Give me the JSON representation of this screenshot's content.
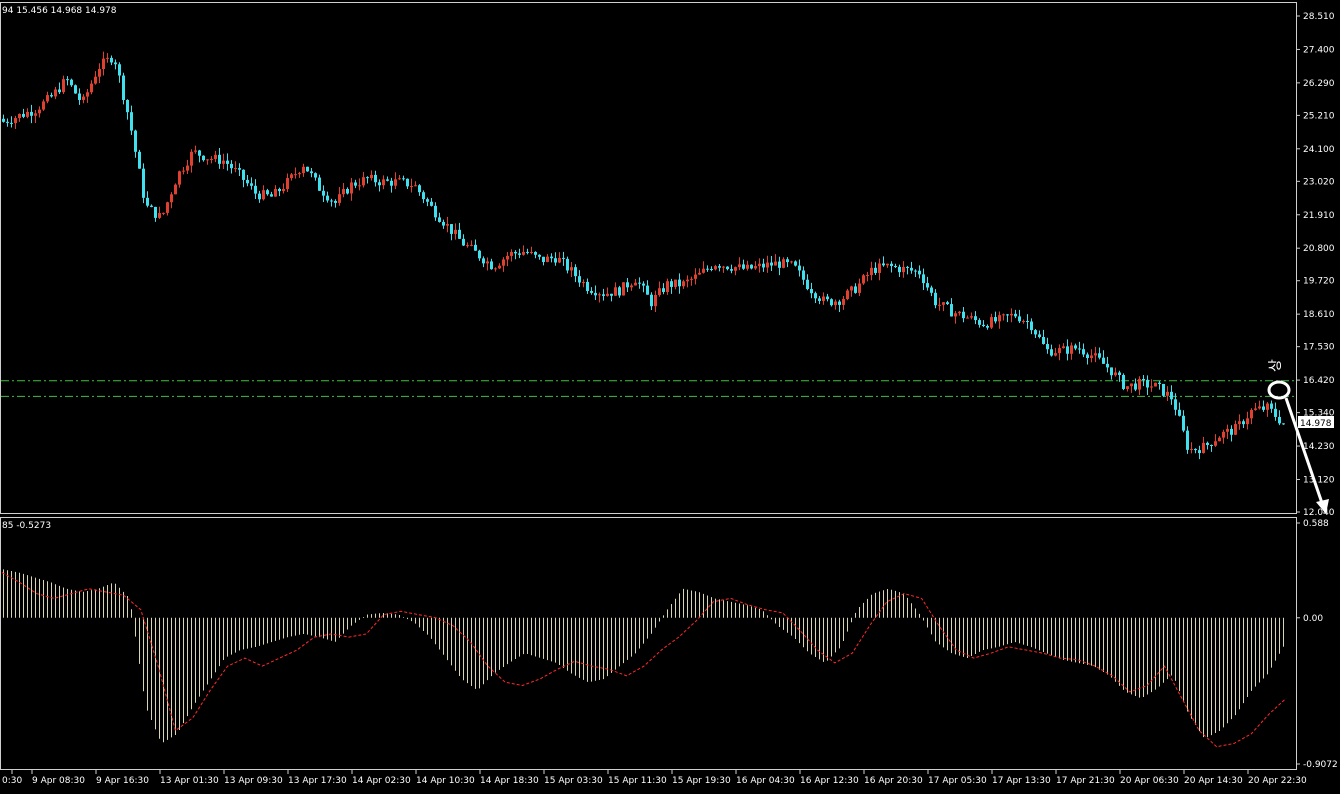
{
  "header": {
    "price_info": "94 15.456 14.968 14.978",
    "macd_info": "85 -0.5273"
  },
  "colors": {
    "background": "#000000",
    "bull_candle": "#e0402f",
    "bear_candle": "#40e0ee",
    "grid_line": "#2a2a2a",
    "axis_text": "#ffffff",
    "level_line": "#3ec43e",
    "histogram": "#d8d6b0",
    "signal_line": "#ff2a2a",
    "annotation": "#ffffff",
    "current_price_box": "#ffffff"
  },
  "annotation": {
    "glyph": "상",
    "type": "circle-with-arrow",
    "icon": "arrow-down-right-icon"
  },
  "levels": [
    16.4,
    15.88
  ],
  "current_price": "14.978",
  "chart_data": {
    "type": "candlestick",
    "price_axis": {
      "range": [
        12.04,
        28.51
      ],
      "ticks": [
        "28.510",
        "27.400",
        "26.290",
        "25.210",
        "24.100",
        "23.020",
        "21.910",
        "20.800",
        "19.720",
        "18.610",
        "17.530",
        "16.420",
        "15.340",
        "14.230",
        "13.120",
        "12.040"
      ]
    },
    "macd_axis": {
      "range": [
        -0.9072,
        0.588
      ],
      "ticks": [
        "0.588",
        "0.00",
        "-0.9072"
      ]
    },
    "time_axis": {
      "ticks": [
        "0:30",
        "9 Apr 08:30",
        "9 Apr 16:30",
        "13 Apr 01:30",
        "13 Apr 09:30",
        "13 Apr 17:30",
        "14 Apr 02:30",
        "14 Apr 10:30",
        "14 Apr 18:30",
        "15 Apr 03:30",
        "15 Apr 11:30",
        "15 Apr 19:30",
        "16 Apr 04:30",
        "16 Apr 12:30",
        "16 Apr 20:30",
        "17 Apr 05:30",
        "17 Apr 13:30",
        "17 Apr 21:30",
        "20 Apr 06:30",
        "20 Apr 14:30",
        "20 Apr 22:30"
      ]
    },
    "price_path": [
      25.0,
      25.2,
      25.4,
      25.8,
      26.4,
      25.6,
      26.8,
      27.2,
      25.0,
      22.2,
      21.8,
      23.2,
      24.0,
      23.8,
      23.7,
      23.2,
      22.6,
      22.5,
      23.0,
      23.6,
      22.8,
      22.3,
      22.9,
      23.1,
      23.0,
      23.0,
      22.9,
      22.2,
      21.6,
      21.0,
      20.6,
      20.2,
      20.6,
      20.7,
      20.4,
      20.5,
      20.0,
      19.5,
      19.3,
      19.4,
      19.8,
      19.0,
      19.6,
      19.6,
      19.9,
      20.3,
      20.2,
      20.1,
      20.2,
      20.3,
      20.2,
      19.5,
      19.0,
      19.1,
      19.5,
      20.1,
      20.2,
      20.1,
      20.0,
      19.0,
      18.7,
      18.5,
      18.3,
      18.4,
      18.6,
      18.3,
      17.4,
      17.4,
      17.5,
      17.2,
      16.8,
      16.2,
      16.3,
      16.2,
      15.8,
      14.1,
      14.2,
      14.6,
      14.8,
      15.4,
      15.5,
      14.98
    ],
    "macd_hist": [
      0.3,
      0.28,
      0.25,
      0.22,
      0.18,
      0.16,
      0.18,
      0.22,
      0.12,
      -0.55,
      -0.78,
      -0.72,
      -0.55,
      -0.4,
      -0.25,
      -0.2,
      -0.18,
      -0.15,
      -0.12,
      -0.1,
      -0.12,
      -0.15,
      -0.05,
      0.02,
      0.03,
      0.02,
      -0.03,
      -0.12,
      -0.25,
      -0.38,
      -0.45,
      -0.35,
      -0.28,
      -0.22,
      -0.25,
      -0.28,
      -0.35,
      -0.4,
      -0.38,
      -0.3,
      -0.22,
      -0.1,
      0.05,
      0.18,
      0.16,
      0.12,
      0.1,
      0.08,
      0.05,
      -0.05,
      -0.12,
      -0.22,
      -0.28,
      -0.18,
      0.05,
      0.15,
      0.18,
      0.15,
      0.02,
      -0.15,
      -0.22,
      -0.25,
      -0.2,
      -0.18,
      -0.15,
      -0.18,
      -0.22,
      -0.26,
      -0.28,
      -0.3,
      -0.36,
      -0.46,
      -0.5,
      -0.44,
      -0.35,
      -0.6,
      -0.75,
      -0.7,
      -0.6,
      -0.45,
      -0.35,
      -0.18
    ],
    "macd_signal": [
      0.28,
      0.22,
      0.15,
      0.12,
      0.15,
      0.18,
      0.16,
      0.14,
      0.05,
      -0.3,
      -0.7,
      -0.62,
      -0.45,
      -0.3,
      -0.25,
      -0.3,
      -0.25,
      -0.2,
      -0.12,
      -0.1,
      -0.12,
      -0.1,
      0.02,
      0.04,
      0.02,
      0.0,
      -0.05,
      -0.15,
      -0.3,
      -0.4,
      -0.42,
      -0.38,
      -0.32,
      -0.27,
      -0.3,
      -0.32,
      -0.36,
      -0.3,
      -0.2,
      -0.12,
      -0.02,
      0.1,
      0.12,
      0.08,
      0.05,
      0.03,
      -0.08,
      -0.2,
      -0.28,
      -0.22,
      -0.05,
      0.1,
      0.15,
      0.12,
      -0.05,
      -0.2,
      -0.25,
      -0.22,
      -0.18,
      -0.2,
      -0.22,
      -0.25,
      -0.26,
      -0.3,
      -0.36,
      -0.46,
      -0.42,
      -0.3,
      -0.5,
      -0.7,
      -0.8,
      -0.78,
      -0.72,
      -0.6,
      -0.5
    ]
  }
}
